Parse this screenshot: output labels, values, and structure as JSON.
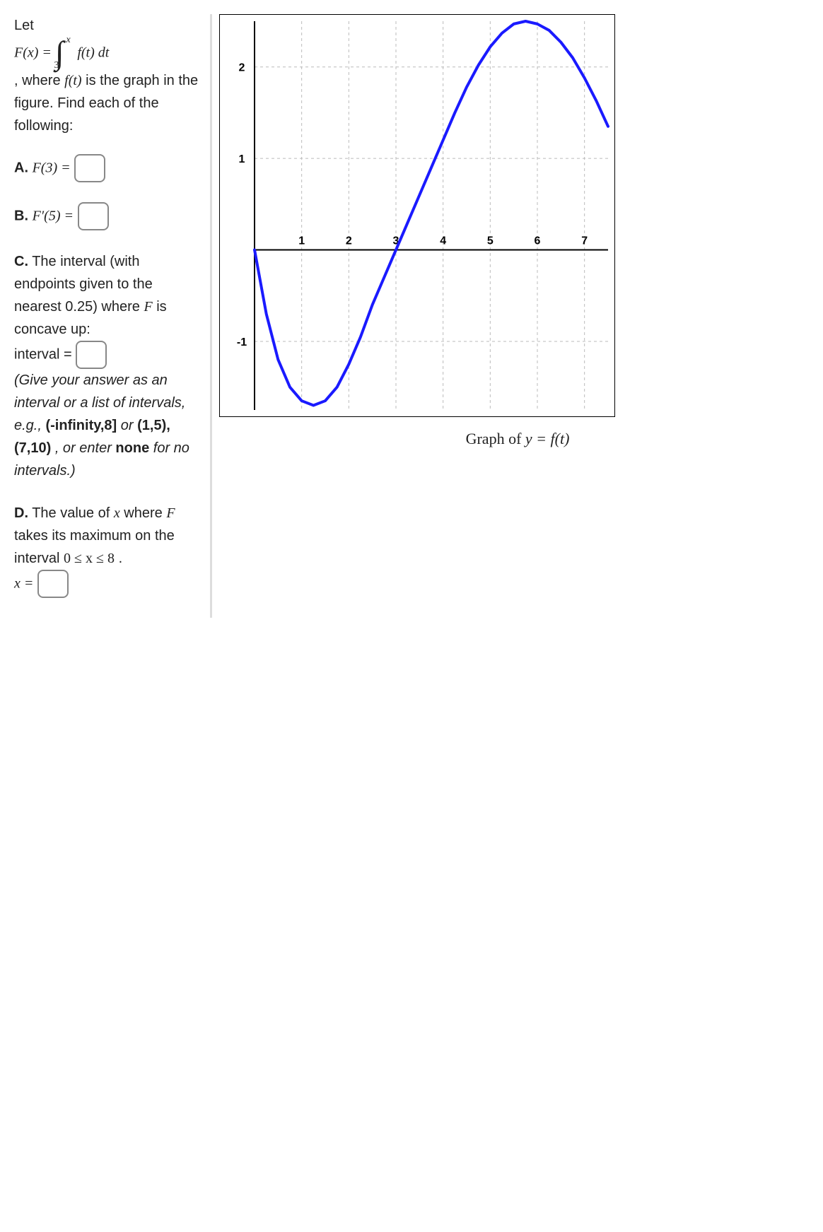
{
  "intro": {
    "let": "Let",
    "F_of_x_eq": "F(x) =",
    "integral_lower": "3",
    "integral_upper": "x",
    "integrand": "f(t) dt",
    "where_text": ", where",
    "f_of_t": "f(t)",
    "is_the_graph": "is the graph in the figure. Find each of the following:"
  },
  "parts": {
    "A": {
      "label": "A.",
      "expr": "F(3) ="
    },
    "B": {
      "label": "B.",
      "expr": "F′(5) ="
    },
    "C": {
      "label": "C.",
      "text1": "The interval (with endpoints given to the nearest 0.25) where",
      "F_is": "F",
      "text2": "is concave up:",
      "interval_eq": "interval =",
      "hint_open": "(Give your answer as an interval or a list of intervals, e.g.,",
      "hint_ex1": "(-infinity,8]",
      "hint_or1": "or",
      "hint_ex2": "(1,5),(7,10)",
      "hint_or2": ", or enter",
      "hint_none": "none",
      "hint_close": "for no intervals.)"
    },
    "D": {
      "label": "D.",
      "text1": "The value of",
      "x_var": "x",
      "text2": "where",
      "F_var": "F",
      "text3": "takes its maximum on the interval",
      "range": "0 ≤ x ≤ 8",
      "period": ".",
      "x_eq": "x ="
    }
  },
  "chart_caption": "Graph of y = f(t)",
  "chart_data": {
    "type": "line",
    "title": "",
    "xlabel": "",
    "ylabel": "",
    "xlim": [
      0,
      7.5
    ],
    "ylim": [
      -1.75,
      2.5
    ],
    "xticks": [
      1,
      2,
      3,
      4,
      5,
      6,
      7
    ],
    "yticks": [
      -1,
      1,
      2
    ],
    "series": [
      {
        "name": "f(t)",
        "color": "#1a1aff",
        "x": [
          0,
          0.25,
          0.5,
          0.75,
          1.0,
          1.25,
          1.5,
          1.75,
          2.0,
          2.25,
          2.5,
          2.75,
          3.0,
          3.25,
          3.5,
          3.75,
          4.0,
          4.25,
          4.5,
          4.75,
          5.0,
          5.25,
          5.5,
          5.75,
          6.0,
          6.25,
          6.5,
          6.75,
          7.0,
          7.25,
          7.5
        ],
        "values": [
          0.0,
          -0.7,
          -1.2,
          -1.5,
          -1.65,
          -1.7,
          -1.65,
          -1.5,
          -1.25,
          -0.95,
          -0.6,
          -0.3,
          0.0,
          0.3,
          0.6,
          0.9,
          1.2,
          1.5,
          1.78,
          2.02,
          2.22,
          2.37,
          2.47,
          2.5,
          2.47,
          2.4,
          2.27,
          2.1,
          1.88,
          1.63,
          1.35
        ]
      }
    ]
  }
}
